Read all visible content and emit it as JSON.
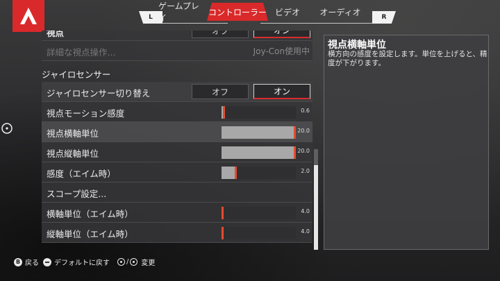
{
  "nav": {
    "left_bumper": "L",
    "right_bumper": "R",
    "tabs": [
      "ゲームプレイ",
      "コントローラー",
      "ビデオ",
      "オーディオ"
    ],
    "active_tab": "コントローラー"
  },
  "rows": {
    "cutoff_label": "視点",
    "cutoff_toggle_off": "オフ",
    "cutoff_toggle_on": "オン",
    "advanced_look": {
      "label": "詳細な視点操作...",
      "right_text": "Joy-Con使用中"
    }
  },
  "section_title": "ジャイロセンサー",
  "gyro_toggle": {
    "label": "ジャイロセンサー切り替え",
    "off_label": "オフ",
    "on_label": "オン",
    "selected": "オン"
  },
  "sliders": [
    {
      "label": "視点モーション感度",
      "value_text": "0.6",
      "fill": 0.02
    },
    {
      "label": "視点横軸単位",
      "value_text": "20.0",
      "fill": 1.0
    },
    {
      "label": "視点縦軸単位",
      "value_text": "20.0",
      "fill": 1.0
    },
    {
      "label": "感度（エイム時）",
      "value_text": "2.0",
      "fill": 0.18
    }
  ],
  "scope_settings": "スコープ設定...",
  "aim_sliders": [
    {
      "label": "横軸単位（エイム時）",
      "value_text": "4.0",
      "fill": 0.0
    },
    {
      "label": "縦軸単位（エイム時）",
      "value_text": "4.0",
      "fill": 0.0
    }
  ],
  "description": {
    "title": "視点横軸単位",
    "body": "横方向の感度を設定します。単位を上げると、精度が下がります。"
  },
  "footer": {
    "back_button": "B",
    "back_label": "戻る",
    "default_label": "デフォルトに戻す",
    "slash": "/",
    "change_label": "変更"
  },
  "colors": {
    "accent": "#da292a",
    "knob": "#e44a2f"
  }
}
